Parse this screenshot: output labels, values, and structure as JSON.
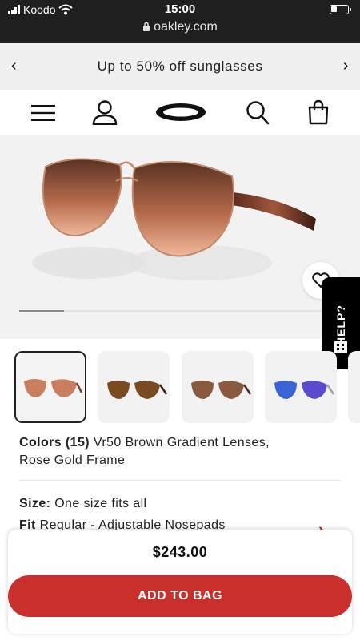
{
  "status_bar": {
    "carrier": "Koodo",
    "time": "15:00",
    "url": "oakley.com"
  },
  "promo": {
    "text": "Up to 50% off sunglasses"
  },
  "nav": {
    "icons": [
      "menu-icon",
      "account-icon",
      "oakley-logo",
      "search-icon",
      "bag-icon"
    ]
  },
  "gallery": {
    "progress": 0.14,
    "thumbnail_count": 5
  },
  "help": {
    "label": "HELP?"
  },
  "product": {
    "colors_label": "Colors (15)",
    "colors_value_line1": "Vr50 Brown Gradient Lenses,",
    "colors_value_line2": "Rose Gold Frame",
    "size_label": "Size:",
    "size_value": "One size fits all",
    "fit_label": "Fit",
    "fit_value": "Regular - Adjustable Nosepads"
  },
  "buy": {
    "price": "$243.00",
    "add_to_bag": "ADD TO BAG"
  },
  "colors": {
    "accent": "#c9302c",
    "status_bar": "#1f1f1f",
    "promo_bg": "#f0f0f0"
  }
}
